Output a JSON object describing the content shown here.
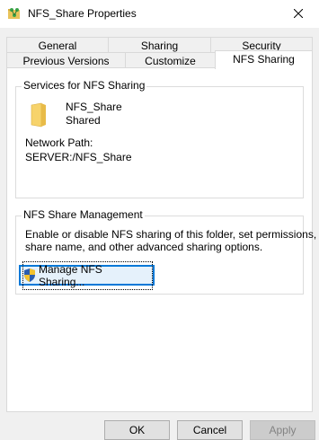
{
  "window": {
    "title": "NFS_Share Properties"
  },
  "tabs": {
    "row1": [
      "General",
      "Sharing",
      "Security"
    ],
    "row2": [
      "Previous Versions",
      "Customize",
      "NFS Sharing"
    ],
    "active": "NFS Sharing"
  },
  "services": {
    "group_label": "Services for NFS Sharing",
    "share_name": "NFS_Share",
    "share_status": "Shared",
    "network_path_label": "Network Path:",
    "network_path_value": "SERVER:/NFS_Share"
  },
  "management": {
    "group_label": "NFS Share Management",
    "description_line1": "Enable or disable NFS sharing of this folder, set permissions,",
    "description_line2": "share name, and other advanced sharing options.",
    "manage_button_label": "Manage NFS Sharing..."
  },
  "buttons": {
    "ok": "OK",
    "cancel": "Cancel",
    "apply": "Apply"
  },
  "colors": {
    "accent": "#0078d7",
    "folder": "#f7d36b",
    "shield_blue": "#2a5db0",
    "shield_yellow": "#f2c12e"
  },
  "icons": {
    "title": "folder-share-icon",
    "close": "close-icon",
    "folder": "folder-icon",
    "shield": "uac-shield-icon"
  }
}
